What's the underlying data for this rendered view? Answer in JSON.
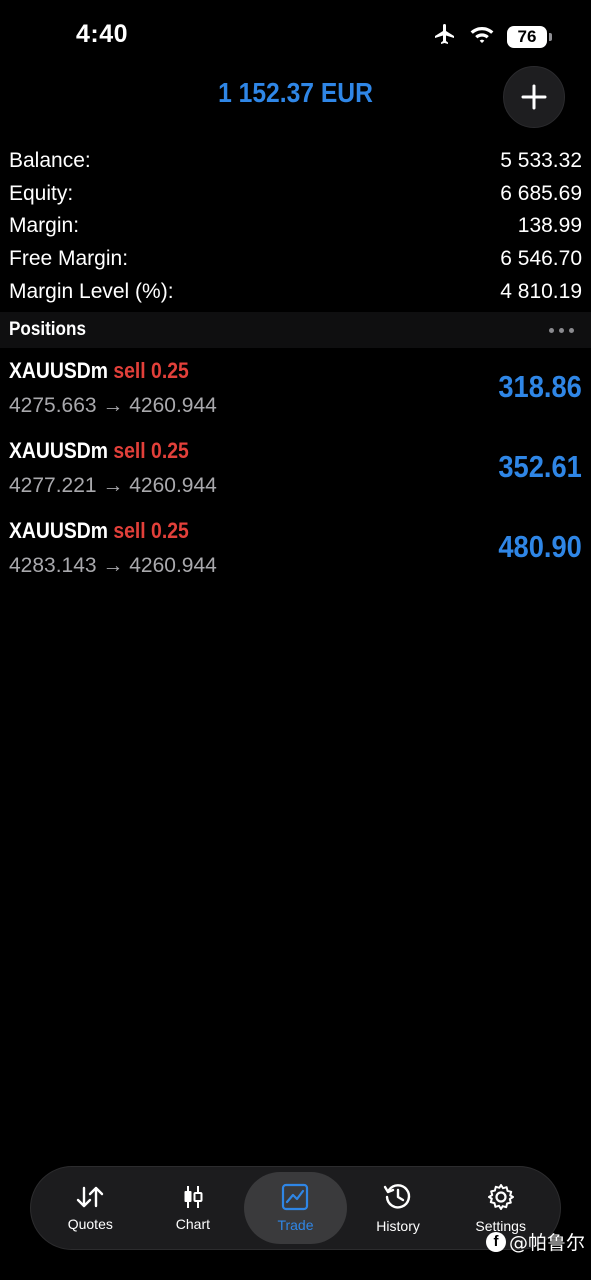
{
  "status_bar": {
    "time": "4:40",
    "battery": "76",
    "icons": [
      "airplane-icon",
      "wifi-icon",
      "battery-icon"
    ]
  },
  "header": {
    "total": "1 152.37 EUR",
    "add_icon": "plus-icon"
  },
  "summary": [
    {
      "label": "Balance:",
      "value": "5 533.32"
    },
    {
      "label": "Equity:",
      "value": "6 685.69"
    },
    {
      "label": "Margin:",
      "value": "138.99"
    },
    {
      "label": "Free Margin:",
      "value": "6 546.70"
    },
    {
      "label": "Margin Level (%):",
      "value": "4 810.19"
    }
  ],
  "positions": {
    "title": "Positions",
    "items": [
      {
        "symbol": "XAUUSDm",
        "side": "sell",
        "volume": "0.25",
        "prices": "4275.663 → 4260.944",
        "profit": "318.86"
      },
      {
        "symbol": "XAUUSDm",
        "side": "sell",
        "volume": "0.25",
        "prices": "4277.221 → 4260.944",
        "profit": "352.61"
      },
      {
        "symbol": "XAUUSDm",
        "side": "sell",
        "volume": "0.25",
        "prices": "4283.143 → 4260.944",
        "profit": "480.90"
      }
    ]
  },
  "tabs": [
    {
      "label": "Quotes",
      "icon": "quotes-arrows-icon",
      "active": false
    },
    {
      "label": "Chart",
      "icon": "candlestick-icon",
      "active": false
    },
    {
      "label": "Trade",
      "icon": "trade-chart-icon",
      "active": true
    },
    {
      "label": "History",
      "icon": "history-clock-icon",
      "active": false
    },
    {
      "label": "Settings",
      "icon": "gear-icon",
      "active": false
    }
  ],
  "watermark": {
    "text": "@帕鲁尔",
    "badge": "f"
  },
  "colors": {
    "accent": "#2f86e6",
    "sell": "#e2403a",
    "background": "#000000"
  }
}
